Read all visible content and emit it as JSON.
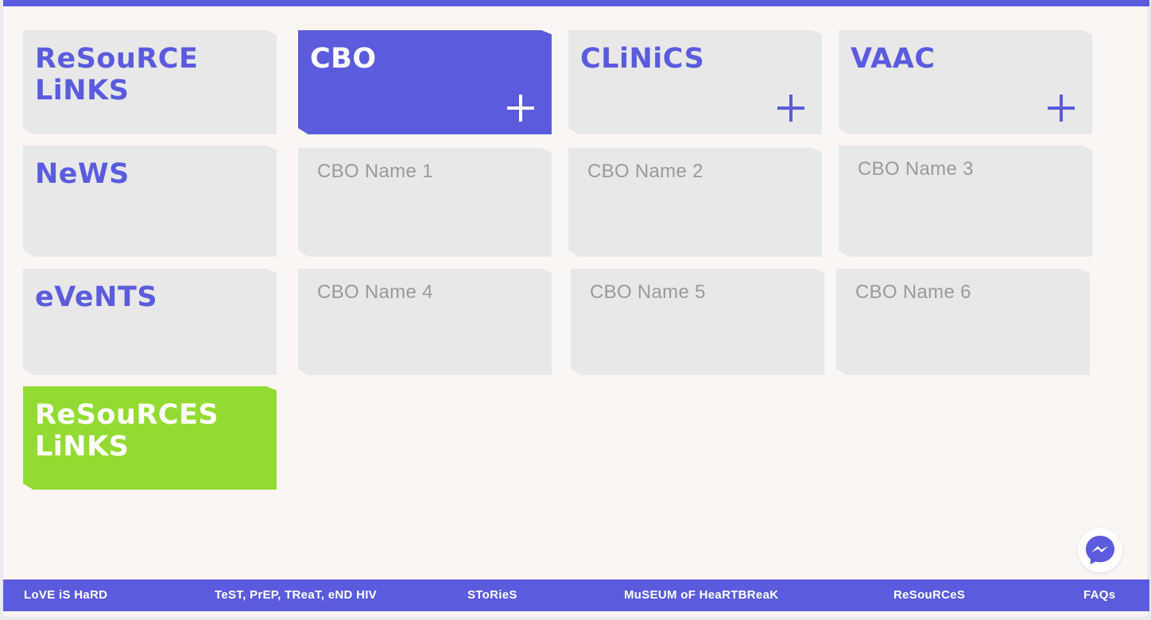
{
  "colors": {
    "accent": "#5b5bdd",
    "green": "#93db32",
    "card_bg": "#e8e8e8",
    "page_bg": "#fbf6f4",
    "muted_text": "#9a9a9a"
  },
  "sidebar": {
    "resource_links": "ReSouRCE\nLiNKS",
    "news": "NeWS",
    "events": "eVeNTS",
    "resources_links_active": "ReSouRCES\nLiNKS"
  },
  "categories": [
    {
      "label": "CBO",
      "icon": "plus-icon",
      "active": true
    },
    {
      "label": "CLiNiCS",
      "icon": "plus-icon",
      "active": false
    },
    {
      "label": "VAAC",
      "icon": "plus-icon",
      "active": false
    }
  ],
  "cbo_list": [
    "CBO Name 1",
    "CBO Name 2",
    "CBO Name 3",
    "CBO Name 4",
    "CBO Name 5",
    "CBO Name 6"
  ],
  "messenger": {
    "icon": "messenger-icon"
  },
  "footer": {
    "nav": [
      "LoVE iS HaRD",
      "TeST, PrEP, TReaT, eND HIV",
      "SToRieS",
      "MuSEUM oF HeaRTBReaK",
      "ReSouRCeS",
      "FAQs"
    ]
  }
}
